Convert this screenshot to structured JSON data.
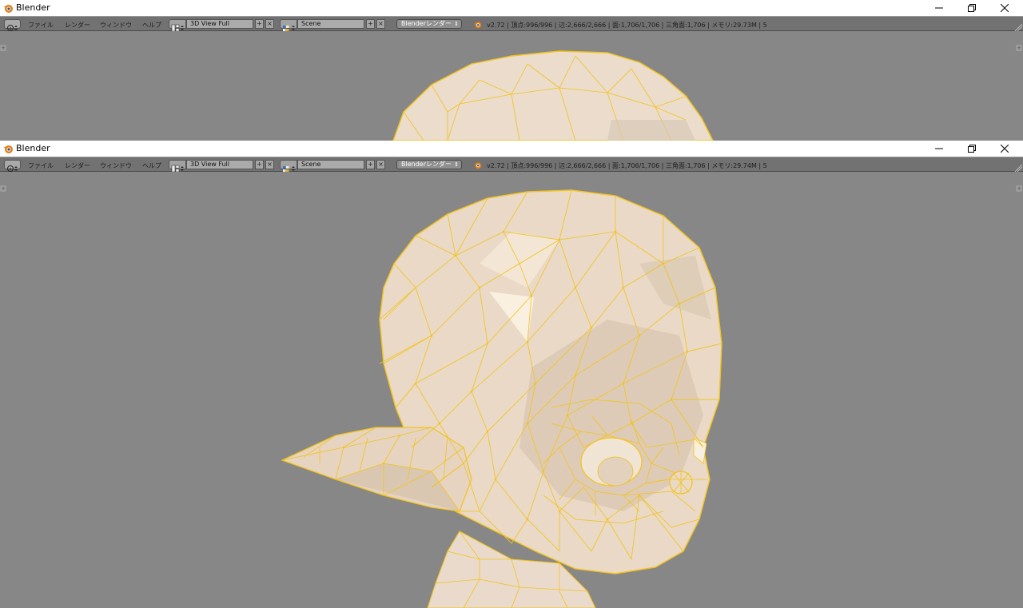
{
  "windows": [
    {
      "title": "Blender",
      "menu": [
        "ファイル",
        "レンダー",
        "ウィンドウ",
        "ヘルプ"
      ],
      "screen_layout": "3D View Full",
      "scene": "Scene",
      "render_engine": "Blenderレンダー",
      "stats": "v2.72 | 頂点:996/996 | 辺:2,666/2,666 | 面:1,706/1,706 | 三角面:1,706 | メモリ:29.73M | 5"
    },
    {
      "title": "Blender",
      "menu": [
        "ファイル",
        "レンダー",
        "ウィンドウ",
        "ヘルプ"
      ],
      "screen_layout": "3D View Full",
      "scene": "Scene",
      "render_engine": "Blenderレンダー",
      "stats": "v2.72 | 頂点:996/996 | 辺:2,666/2,666 | 面:1,706/1,706 | 三角面:1,706 | メモリ:29.74M | 5"
    }
  ],
  "colors": {
    "viewport_bg": "#878787",
    "header_bg": "#727272",
    "mesh_fill": "#e8d7c4",
    "wire": "#f3c318"
  }
}
